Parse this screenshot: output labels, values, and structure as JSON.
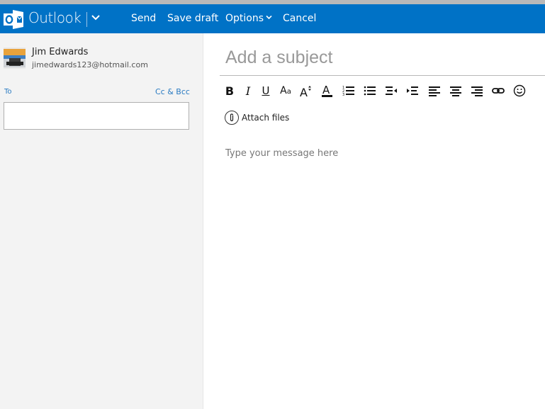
{
  "header": {
    "brand": "Outlook",
    "actions": {
      "send": "Send",
      "save_draft": "Save draft",
      "options": "Options",
      "cancel": "Cancel"
    },
    "color": "#0072c6"
  },
  "sender": {
    "name": "Jim Edwards",
    "email": "jimedwards123@hotmail.com"
  },
  "recipients": {
    "to_label": "To",
    "cc_bcc_label": "Cc & Bcc",
    "to_value": ""
  },
  "compose": {
    "subject_placeholder": "Add a subject",
    "subject_value": "",
    "message_placeholder": "Type your message here",
    "attach_label": "Attach files"
  },
  "toolbar": {
    "buttons": [
      "bold",
      "italic",
      "underline",
      "font-face",
      "font-size",
      "font-color",
      "numbered-list",
      "bulleted-list",
      "decrease-indent",
      "increase-indent",
      "align-left",
      "align-center",
      "align-right",
      "insert-link",
      "emoji"
    ]
  }
}
